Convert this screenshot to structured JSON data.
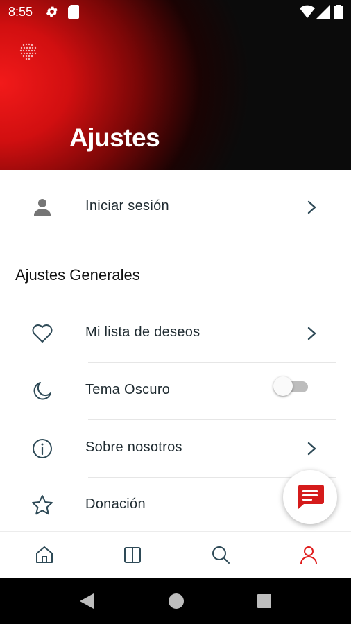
{
  "status_bar": {
    "time": "8:55"
  },
  "header": {
    "title": "Ajustes"
  },
  "login": {
    "label": "Iniciar sesión"
  },
  "general": {
    "section_title": "Ajustes Generales",
    "items": [
      {
        "label": "Mi lista de deseos",
        "icon": "heart-icon"
      },
      {
        "label": "Tema Oscuro",
        "icon": "moon-icon",
        "toggle": false
      },
      {
        "label": "Sobre nosotros",
        "icon": "info-icon"
      },
      {
        "label": "Donación",
        "icon": "star-icon"
      }
    ]
  },
  "bottom_nav": [
    "home-icon",
    "book-icon",
    "search-icon",
    "profile-icon"
  ],
  "colors": {
    "accent": "#e01b1b",
    "icon": "#2e4a57"
  }
}
